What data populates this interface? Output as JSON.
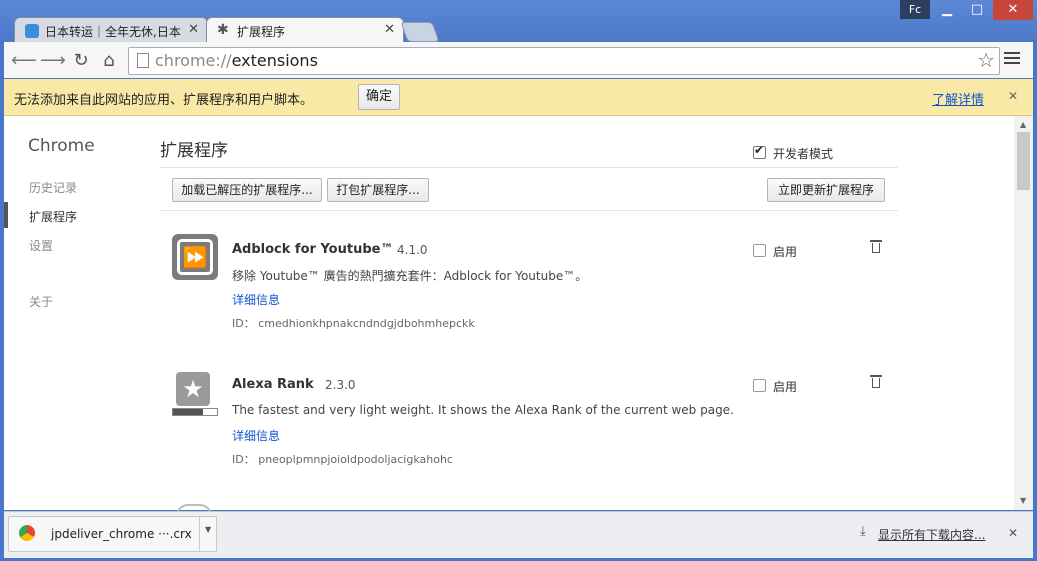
{
  "window": {
    "profile": "Fc",
    "minimize": "▁",
    "maximize": "□",
    "close": "✕"
  },
  "tabs": [
    {
      "title": "日本转运｜全年无休,日本",
      "close": "✕"
    },
    {
      "title": "扩展程序",
      "close": "✕"
    }
  ],
  "toolbar": {
    "url_scheme": "chrome://",
    "url_path": "extensions"
  },
  "infobar": {
    "message": "无法添加来自此网站的应用、扩展程序和用户脚本。",
    "ok_label": "确定",
    "learn_more": "了解详情",
    "close": "✕"
  },
  "sidebar": {
    "title": "Chrome",
    "items": [
      {
        "label": "历史记录"
      },
      {
        "label": "扩展程序"
      },
      {
        "label": "设置"
      },
      {
        "label": "关于"
      }
    ]
  },
  "main": {
    "title": "扩展程序",
    "dev_mode_label": "开发者模式",
    "load_unpacked": "加载已解压的扩展程序...",
    "pack_extension": "打包扩展程序...",
    "update_now": "立即更新扩展程序"
  },
  "extensions": [
    {
      "name": "Adblock for Youtube™",
      "version": "4.1.0",
      "description": "移除 Youtube™ 廣告的熱門擴充套件：Adblock for Youtube™。",
      "details": "详细信息",
      "id_label": "ID：",
      "id": "cmedhionkhpnakcndndgjdbohmhepckk",
      "enable_label": "启用"
    },
    {
      "name": "Alexa Rank",
      "version": "2.3.0",
      "description": "The fastest and very light weight. It shows the Alexa Rank of the current web page.",
      "details": "详细信息",
      "id_label": "ID：",
      "id": "pneoplpmnpjoioldpodoljacigkahohc",
      "enable_label": "启用"
    }
  ],
  "downloads": {
    "file": "jpdeliver_chrome ···.crx",
    "show_all": "显示所有下载内容...",
    "close": "✕"
  }
}
